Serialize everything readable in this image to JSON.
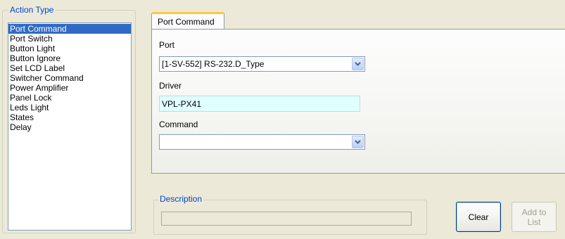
{
  "action_type": {
    "legend": "Action Type",
    "items": [
      {
        "label": "Port Command",
        "selected": true
      },
      {
        "label": "Port Switch"
      },
      {
        "label": "Button Light"
      },
      {
        "label": "Button Ignore"
      },
      {
        "label": "Set LCD Label"
      },
      {
        "label": "Switcher Command"
      },
      {
        "label": "Power Amplifier"
      },
      {
        "label": "Panel Lock"
      },
      {
        "label": "Leds Light"
      },
      {
        "label": "States"
      },
      {
        "label": "Delay"
      }
    ]
  },
  "tab": {
    "label": "Port Command",
    "port": {
      "label": "Port",
      "value": "[1-SV-552] RS-232.D_Type"
    },
    "driver": {
      "label": "Driver",
      "value": "VPL-PX41"
    },
    "command": {
      "label": "Command",
      "value": ""
    }
  },
  "description": {
    "legend": "Description",
    "value": ""
  },
  "buttons": {
    "clear": "Clear",
    "add_line1": "Add to",
    "add_line2": "List"
  },
  "icons": {
    "dropdown": "chevron-down-icon"
  },
  "colors": {
    "selection": "#316AC5",
    "legend": "#0046D5",
    "driver_bg": "#E0FFFF",
    "tab_accent": "#FFC83C"
  }
}
